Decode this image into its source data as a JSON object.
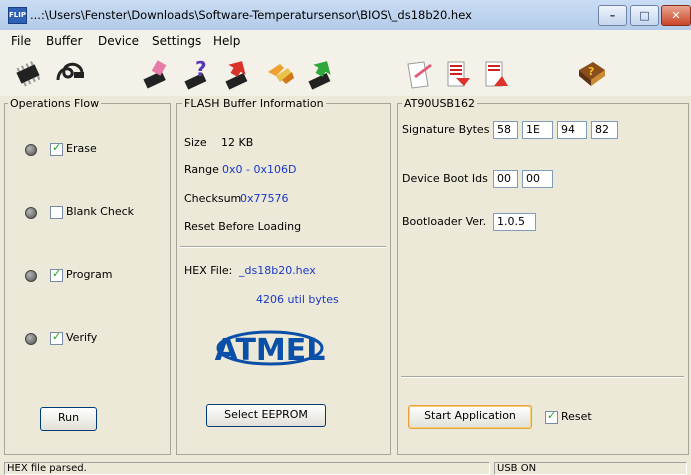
{
  "window": {
    "title": "...:\\Users\\Fenster\\Downloads\\Software-Temperatursensor\\BIOS\\_ds18b20.hex",
    "app_icon_text": "FLIP"
  },
  "menu": [
    "File",
    "Buffer",
    "Device",
    "Settings",
    "Help"
  ],
  "toolbar": {
    "icons": [
      "chip-select-icon",
      "usb-connect-icon",
      "erase-chip-icon",
      "blank-check-icon",
      "program-chip-icon",
      "verify-chip-icon",
      "read-chip-icon",
      "edit-buffer-icon",
      "load-file-icon",
      "save-file-icon",
      "help-book-icon"
    ]
  },
  "operations": {
    "label": "Operations Flow",
    "steps": [
      {
        "label": "Erase",
        "checked": true
      },
      {
        "label": "Blank Check",
        "checked": false
      },
      {
        "label": "Program",
        "checked": true
      },
      {
        "label": "Verify",
        "checked": true
      }
    ],
    "run_label": "Run"
  },
  "flash": {
    "label": "FLASH Buffer Information",
    "size_label": "Size",
    "size_value": "12 KB",
    "range_label": "Range",
    "range_value": "0x0 - 0x106D",
    "checksum_label": "Checksum",
    "checksum_value": "0x77576",
    "reset_label": "Reset Before Loading",
    "hex_label": "HEX File:",
    "hex_value": "_ds18b20.hex",
    "bytes_value": "4206 util bytes",
    "logo_text": "ATMEL",
    "eeprom_label": "Select EEPROM"
  },
  "device": {
    "label": "AT90USB162",
    "signature_label": "Signature Bytes",
    "signature": [
      "58",
      "1E",
      "94",
      "82"
    ],
    "boot_ids_label": "Device Boot Ids",
    "boot_ids": [
      "00",
      "00"
    ],
    "bootloader_label": "Bootloader Ver.",
    "bootloader_value": "1.0.5",
    "start_label": "Start Application",
    "reset_label": "Reset",
    "reset_checked": true
  },
  "status": {
    "left": "HEX file parsed.",
    "right": "USB ON"
  }
}
